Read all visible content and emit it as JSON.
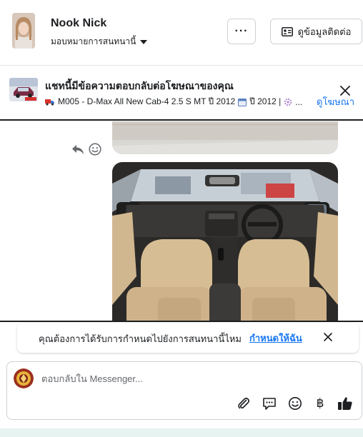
{
  "header": {
    "name": "Nook Nick",
    "assign_label": "มอบหมายการสนทนานี้",
    "more_label": "···",
    "contact_button_label": "ดูข้อมูลติดต่อ"
  },
  "banner": {
    "title": "แชทนี้มีข้อความตอบกลับต่อโฆษณาของคุณ",
    "subtitle": "M005 - D-Max All New Cab-4 2.5 S MT ปี 2012",
    "subtitle_year": "ปี 2012 |",
    "ellipsis": "...",
    "view_ad_label": "ดูโฆษณา"
  },
  "prompt": {
    "text": "คุณต้องการได้รับการกำหนดไปยังการสนทนานี้ไหม",
    "link_label": "กำหนดให้ฉัน"
  },
  "composer": {
    "placeholder": "ตอบกลับใน Messenger...",
    "baht_symbol": "฿"
  },
  "colors": {
    "accent": "#1877f2",
    "border": "#ced0d4",
    "text": "#1c1e21",
    "like": "#1c1e21"
  },
  "icons": [
    "more-icon",
    "contact-card-icon",
    "close-icon",
    "reply-icon",
    "smiley-icon",
    "attach-icon",
    "saved-reply-icon",
    "emoji-icon",
    "baht-icon",
    "like-icon",
    "truck-icon",
    "calendar-icon",
    "gear-icon"
  ]
}
